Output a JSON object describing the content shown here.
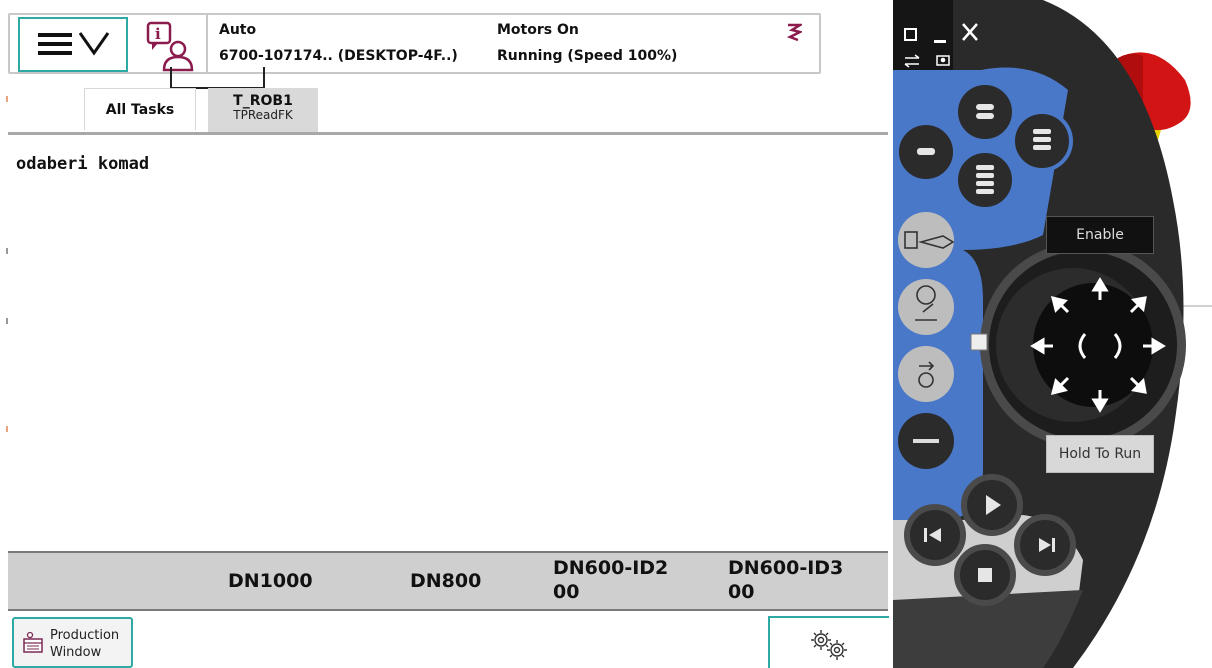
{
  "header": {
    "mode": "Auto",
    "system": "6700-107174.. (DESKTOP-4F..)",
    "motors": "Motors On",
    "state": "Running (Speed 100%)"
  },
  "tabs": [
    {
      "label": "All Tasks"
    },
    {
      "label": "T_ROB1",
      "sub": "TPReadFK"
    }
  ],
  "content": {
    "message": "odaberi komad"
  },
  "function_keys": [
    {
      "label": ""
    },
    {
      "label": "DN1000"
    },
    {
      "label": "DN800"
    },
    {
      "label_line1": "DN600-ID2",
      "label_line2": "00"
    },
    {
      "label_line1": "DN600-ID3",
      "label_line2": "00"
    }
  ],
  "bottom": {
    "production_line1": "Production",
    "production_line2": "Window"
  },
  "hardware": {
    "enable_label": "Enable",
    "hold_label": "Hold To Run"
  },
  "colors": {
    "accent": "#2fa9a3",
    "pendant_blue": "#4a78c8",
    "emergency_red": "#d21414",
    "guard_yellow": "#e8d400",
    "info_icon": "#8b1a4d"
  },
  "icons": [
    "menu-icon",
    "chevron-down-icon",
    "info-user-icon",
    "robot-status-icon",
    "production-window-icon",
    "settings-gears-icon"
  ]
}
